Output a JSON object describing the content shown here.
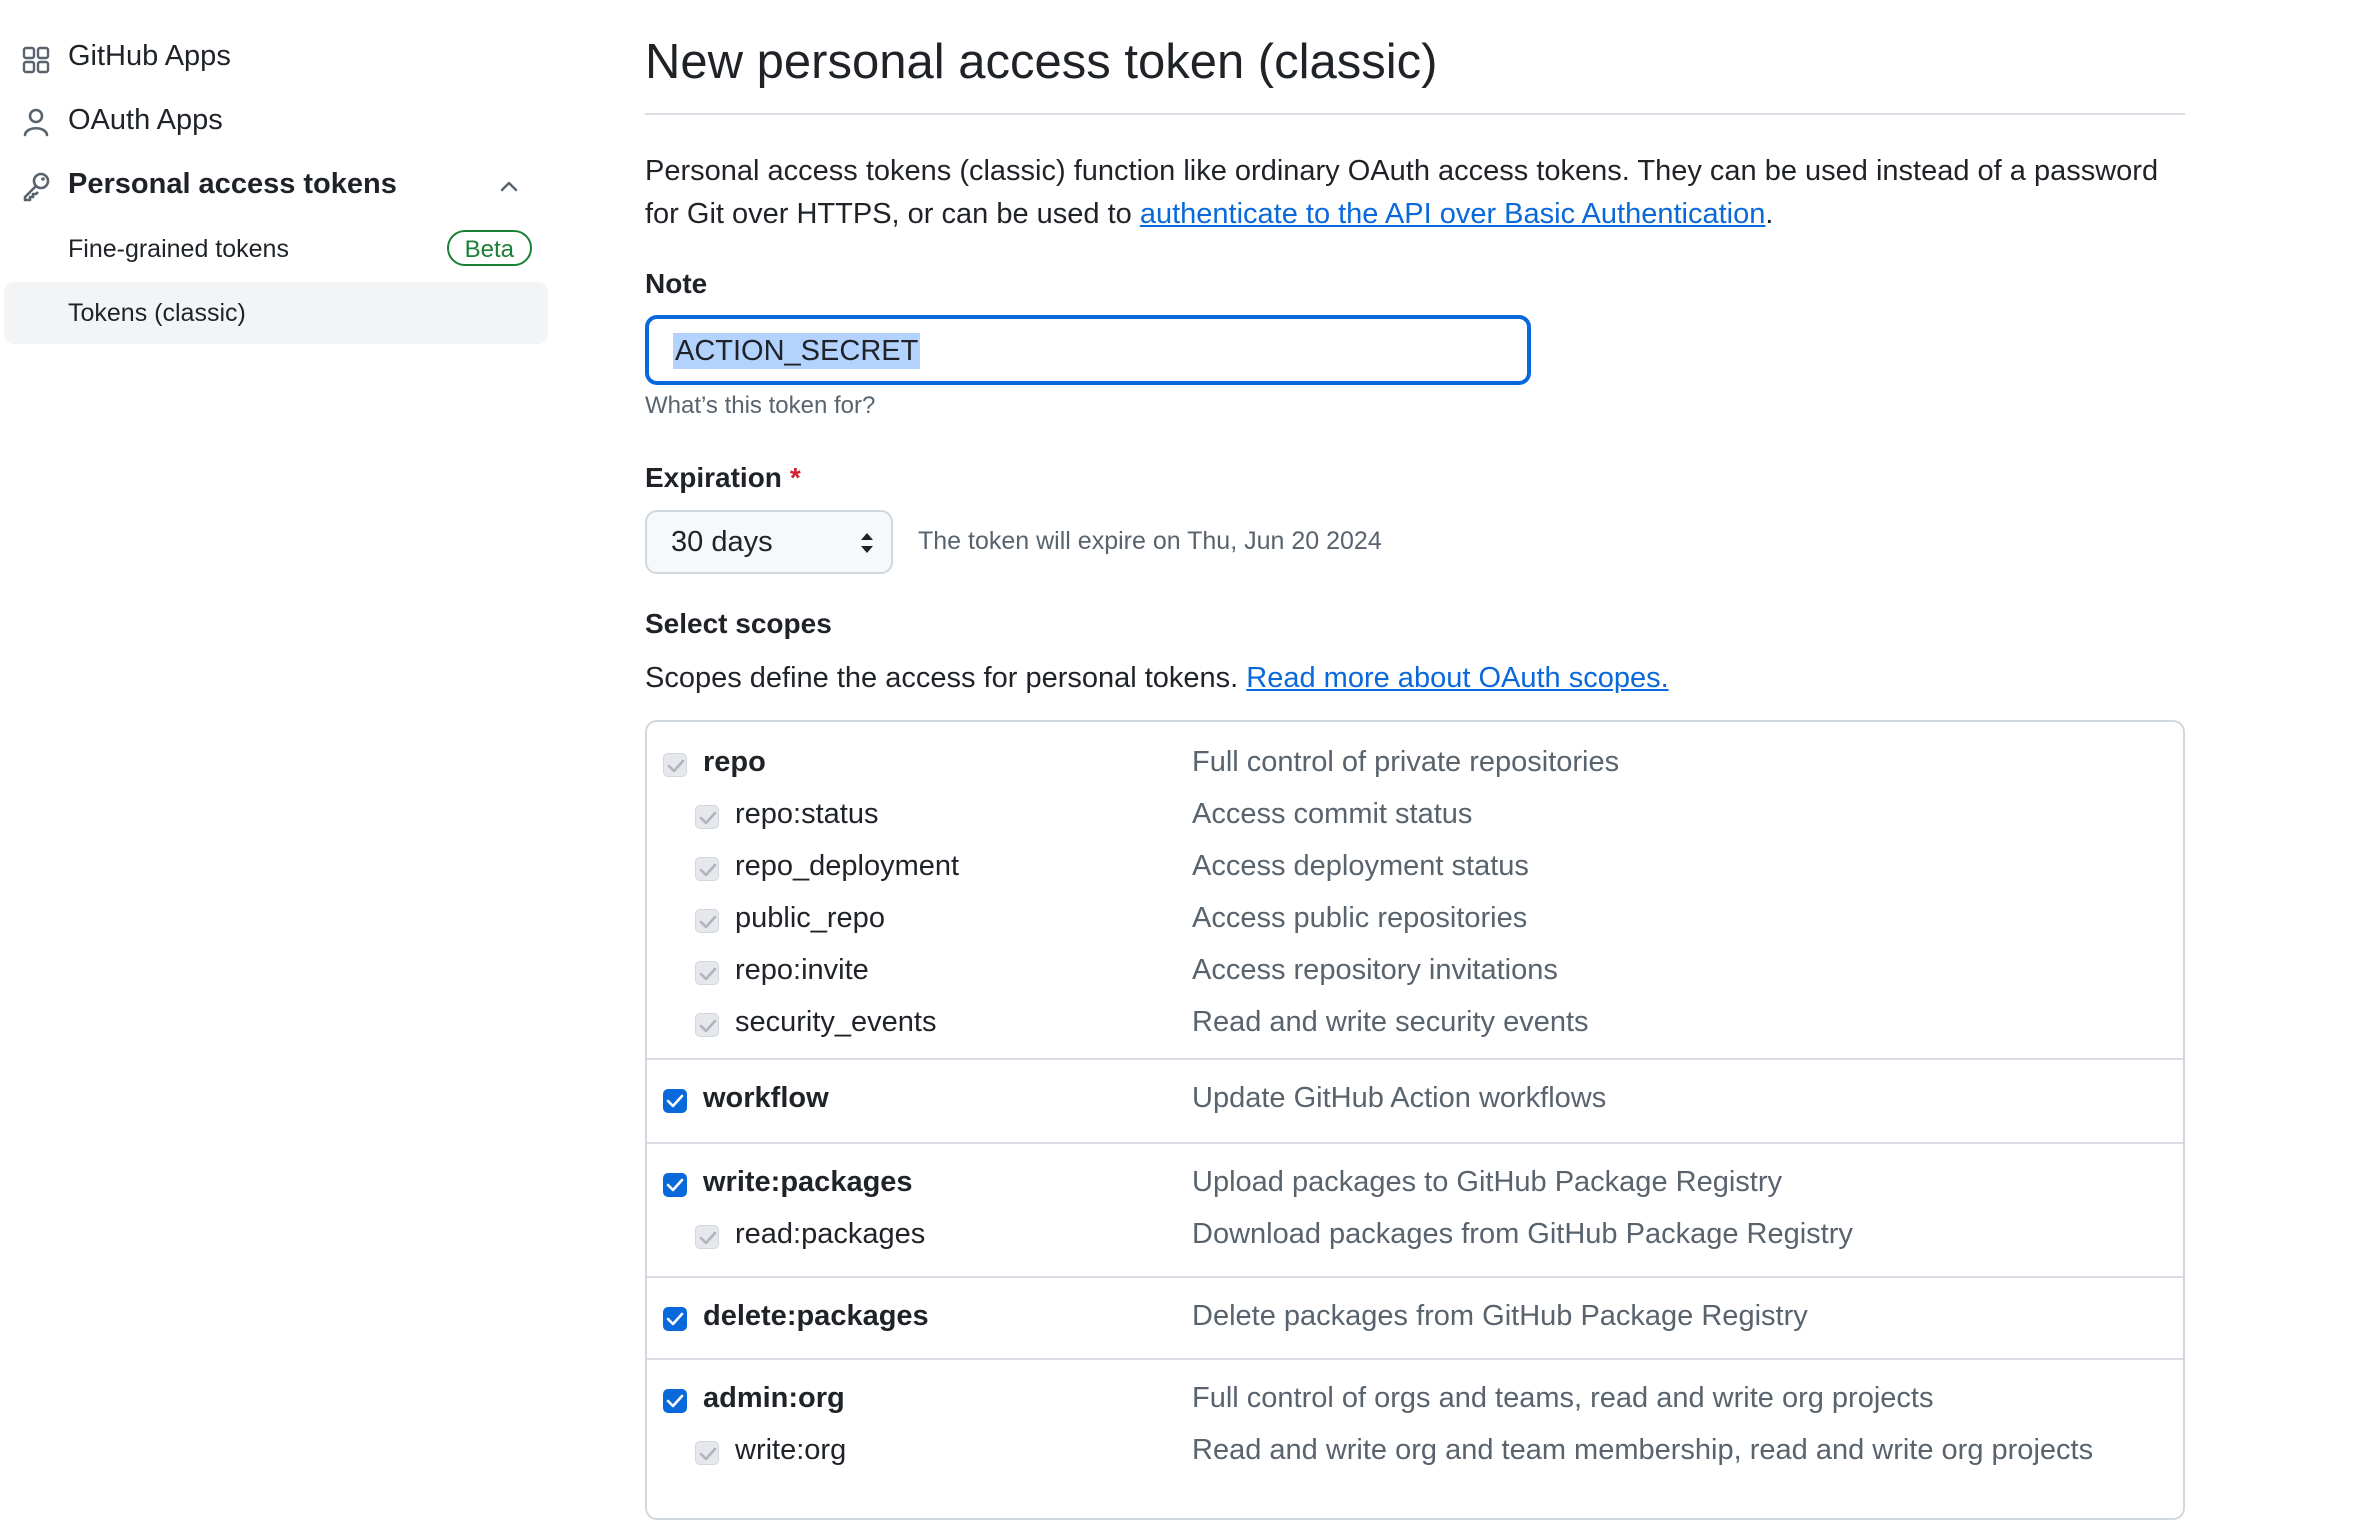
{
  "sidebar": {
    "items": [
      {
        "label": "GitHub Apps",
        "icon": "apps-icon"
      },
      {
        "label": "OAuth Apps",
        "icon": "person-icon"
      },
      {
        "label": "Personal access tokens",
        "icon": "key-icon"
      }
    ],
    "subitems": [
      {
        "label": "Fine-grained tokens",
        "badge": "Beta"
      },
      {
        "label": "Tokens (classic)",
        "active": true
      }
    ]
  },
  "main": {
    "title": "New personal access token (classic)",
    "intro_text": "Personal access tokens (classic) function like ordinary OAuth access tokens. They can be used instead of a password for Git over HTTPS, or can be used to ",
    "intro_link": "authenticate to the API over Basic Authentication",
    "intro_end": ".",
    "note": {
      "label": "Note",
      "value": "ACTION_SECRET",
      "hint": "What’s this token for?"
    },
    "expiration": {
      "label": "Expiration",
      "required_mark": "*",
      "selected": "30 days",
      "info": "The token will expire on Thu, Jun 20 2024"
    },
    "scopes": {
      "heading": "Select scopes",
      "description": "Scopes define the access for personal tokens. ",
      "link": "Read more about OAuth scopes.",
      "groups": [
        {
          "rows": [
            {
              "name": "repo",
              "desc": "Full control of private repositories",
              "checked": false,
              "sub": false
            },
            {
              "name": "repo:status",
              "desc": "Access commit status",
              "checked": false,
              "sub": true
            },
            {
              "name": "repo_deployment",
              "desc": "Access deployment status",
              "checked": false,
              "sub": true
            },
            {
              "name": "public_repo",
              "desc": "Access public repositories",
              "checked": false,
              "sub": true
            },
            {
              "name": "repo:invite",
              "desc": "Access repository invitations",
              "checked": false,
              "sub": true
            },
            {
              "name": "security_events",
              "desc": "Read and write security events",
              "checked": false,
              "sub": true
            }
          ]
        },
        {
          "rows": [
            {
              "name": "workflow",
              "desc": "Update GitHub Action workflows",
              "checked": true,
              "sub": false
            }
          ]
        },
        {
          "rows": [
            {
              "name": "write:packages",
              "desc": "Upload packages to GitHub Package Registry",
              "checked": true,
              "sub": false
            },
            {
              "name": "read:packages",
              "desc": "Download packages from GitHub Package Registry",
              "checked": false,
              "sub": true
            }
          ]
        },
        {
          "rows": [
            {
              "name": "delete:packages",
              "desc": "Delete packages from GitHub Package Registry",
              "checked": true,
              "sub": false
            }
          ]
        },
        {
          "rows": [
            {
              "name": "admin:org",
              "desc": "Full control of orgs and teams, read and write org projects",
              "checked": true,
              "sub": false
            },
            {
              "name": "write:org",
              "desc": "Read and write org and team membership, read and write org projects",
              "checked": false,
              "sub": true
            }
          ]
        }
      ]
    }
  }
}
